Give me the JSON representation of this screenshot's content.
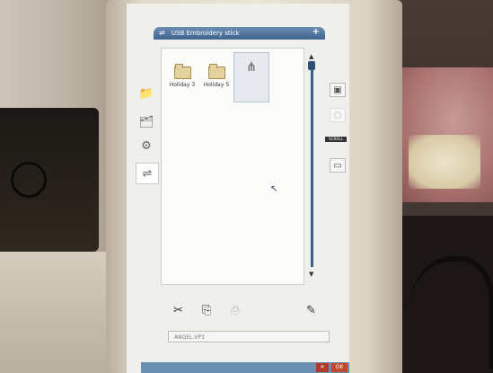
{
  "window": {
    "title": "USB Embroidery stick",
    "title_icon": "usb-icon",
    "add_icon": "plus-icon",
    "add_glyph": "+"
  },
  "left_toolbar": [
    {
      "name": "folder-icon",
      "glyph": "📁",
      "selected": false
    },
    {
      "name": "design-folder-icon",
      "glyph": "🗂",
      "selected": false
    },
    {
      "name": "built-in-designs-icon",
      "glyph": "⚙",
      "selected": false
    },
    {
      "name": "usb-icon",
      "glyph": "⇌",
      "selected": true
    }
  ],
  "files": [
    {
      "label": "Holiday 3",
      "type": "folder",
      "selected": false
    },
    {
      "label": "Holiday 5",
      "type": "folder",
      "selected": false
    },
    {
      "label": "",
      "type": "usb-device",
      "glyph": "⋔",
      "selected": true
    }
  ],
  "scrollbar": {
    "up": "▲",
    "down": "▼"
  },
  "right_toolbar": [
    {
      "name": "folder-up-icon",
      "glyph": "▣"
    },
    {
      "name": "disabled-circle-icon",
      "glyph": "○"
    },
    {
      "name": "new-folder-icon",
      "glyph": "▭"
    }
  ],
  "right_badge": "SCROLL",
  "bottom_toolbar": [
    {
      "name": "cut-icon",
      "glyph": "✂"
    },
    {
      "name": "copy-icon",
      "glyph": "⎘"
    },
    {
      "name": "paste-icon",
      "glyph": "⎙"
    },
    {
      "name": "rename-icon",
      "glyph": "✎"
    }
  ],
  "filename_field": {
    "value": "ANGEL.VP3"
  },
  "footer": {
    "cancel_label": "✕",
    "ok_label": "OK"
  },
  "colors": {
    "titlebar": "#3e6490",
    "scroll": "#3d5f8c",
    "cancel": "#b23a2c"
  }
}
